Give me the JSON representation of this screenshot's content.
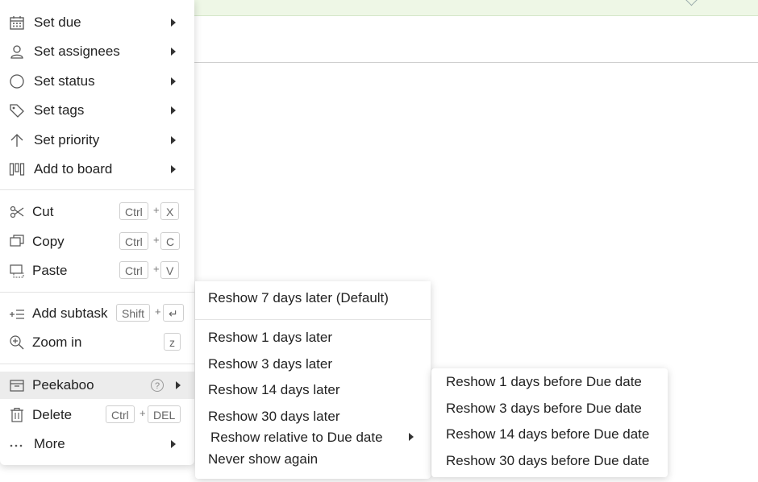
{
  "main_menu": {
    "items": [
      {
        "label": "Set due",
        "icon": "calendar-icon"
      },
      {
        "label": "Set assignees",
        "icon": "user-icon"
      },
      {
        "label": "Set status",
        "icon": "circle-icon"
      },
      {
        "label": "Set tags",
        "icon": "tag-icon"
      },
      {
        "label": "Set priority",
        "icon": "arrow-up-icon"
      },
      {
        "label": "Add to board",
        "icon": "board-icon"
      },
      {
        "label": "Cut",
        "icon": "scissors-icon",
        "keys": [
          "Ctrl",
          "X"
        ]
      },
      {
        "label": "Copy",
        "icon": "copy-icon",
        "keys": [
          "Ctrl",
          "C"
        ]
      },
      {
        "label": "Paste",
        "icon": "paste-icon",
        "keys": [
          "Ctrl",
          "V"
        ]
      },
      {
        "label": "Add subtask",
        "icon": "subtask-icon",
        "keys": [
          "Shift",
          "↵"
        ]
      },
      {
        "label": "Zoom in",
        "icon": "zoom-in-icon",
        "keys": [
          "z"
        ]
      },
      {
        "label": "Peekaboo",
        "icon": "inbox-icon",
        "help": "?"
      },
      {
        "label": "Delete",
        "icon": "trash-icon",
        "keys": [
          "Ctrl",
          "DEL"
        ]
      },
      {
        "label": "More",
        "icon": "more-icon"
      }
    ],
    "plus": "+"
  },
  "peekaboo_menu": {
    "default": "Reshow 7 days later (Default)",
    "options": [
      "Reshow 1 days later",
      "Reshow 3 days later",
      "Reshow 14 days later",
      "Reshow 30 days later"
    ],
    "relative": "Reshow relative to Due date",
    "never": "Never show again"
  },
  "due_date_menu": {
    "options": [
      "Reshow 1 days before Due date",
      "Reshow 3 days before Due date",
      "Reshow 14 days before Due date",
      "Reshow 30 days before Due date"
    ]
  }
}
